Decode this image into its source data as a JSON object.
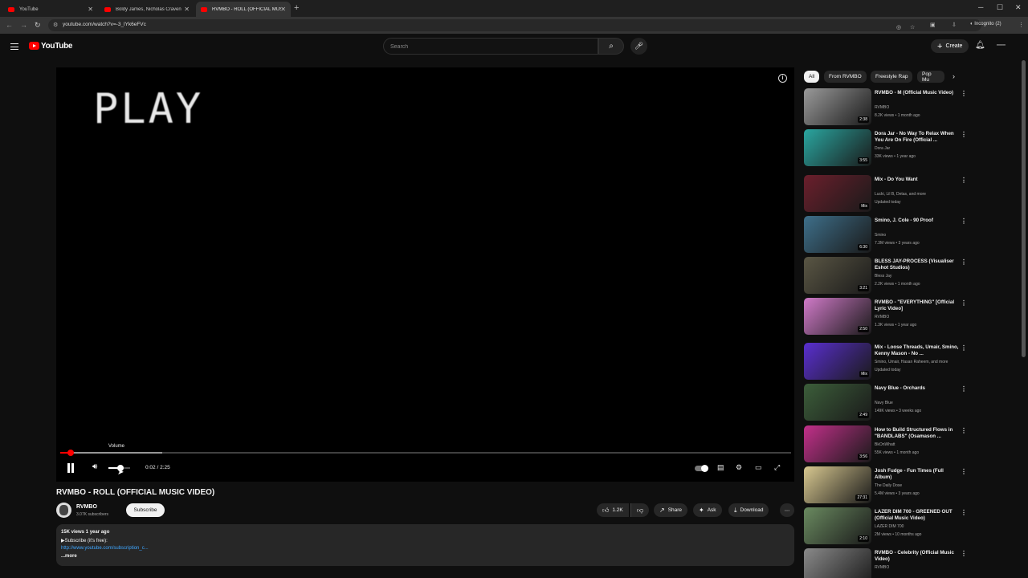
{
  "browser": {
    "tabs": [
      {
        "title": "YouTube"
      },
      {
        "title": "Boldy James, Nicholas Craven"
      },
      {
        "title": "RVMBO - ROLL (OFFICIAL MUSIC"
      }
    ],
    "url": "youtube.com/watch?v=-3_lYk6eFVc",
    "incognito_label": "Incognito (2)"
  },
  "header": {
    "logo_text": "YouTube",
    "search_placeholder": "Search",
    "create_label": "Create"
  },
  "player": {
    "overlay_text": "PLAY",
    "tooltip": "Volume",
    "time": "0:02 / 2:25",
    "progress_fraction": 0.014,
    "buffer_fraction": 0.14,
    "volume_fraction": 0.55
  },
  "video": {
    "title": "RVMBO - ROLL (OFFICIAL MUSIC VIDEO)",
    "channel": "RVMBO",
    "subscribers": "3.07K subscribers",
    "subscribe_label": "Subscribe",
    "likes": "1.2K",
    "share_label": "Share",
    "ask_label": "Ask",
    "download_label": "Download",
    "stats": "15K views  1 year ago",
    "desc_line1": "▶Subscribe (it's free):",
    "desc_link": "http://www.youtube.com/subscription_c...",
    "more_label": "...more"
  },
  "chips": [
    "All",
    "From RVMBO",
    "Freestyle Rap",
    "Pop Mu"
  ],
  "recommendations": [
    {
      "title": "RVMBO - M (Official Music Video)",
      "channel": "RVMBO",
      "meta": "8.2K views • 1 month ago",
      "duration": "2:38",
      "color": "#9a9a9a"
    },
    {
      "title": "Dora Jar - No Way To Relax When You Are On Fire (Official ...",
      "channel": "Dora Jar",
      "meta": "33K views • 1 year ago",
      "duration": "3:55",
      "color": "#2aa6a0"
    },
    {
      "title": "Mix - Do You Want",
      "channel": "Lucki, Lil B, Detas, and more",
      "meta": "Updated today",
      "duration": "Mix",
      "color": "#6b1f2c"
    },
    {
      "title": "Smino, J. Cole - 90 Proof",
      "channel": "Smino",
      "meta": "7.3M views • 3 years ago",
      "duration": "6:30",
      "color": "#3e6f8a"
    },
    {
      "title": "BLESS JAY-PROCESS (Visualiser Eshot Studios)",
      "channel": "Bless Jay",
      "meta": "2.2K views • 1 month ago",
      "duration": "3:21",
      "color": "#5a5644"
    },
    {
      "title": "RVMBO - \"EVERYTHING\" [Official Lyric Video]",
      "channel": "RVMBO",
      "meta": "1.3K views • 1 year ago",
      "duration": "2:50",
      "color": "#d07ac8"
    },
    {
      "title": "Mix - Loose Threads, Umair, Smino, Kenny Mason - No ...",
      "channel": "Smino, Umair, Hasan Raheem, and more",
      "meta": "Updated today",
      "duration": "Mix",
      "color": "#5a2fd0"
    },
    {
      "title": "Navy Blue - Orchards",
      "channel": "Navy Blue",
      "meta": "149K views • 3 weeks ago",
      "duration": "2:49",
      "color": "#3c5e3a"
    },
    {
      "title": "How to Build Structured Flows in \"BANDLABS\" (Osamason ...",
      "channel": "BkOnWhatt",
      "meta": "55K views • 1 month ago",
      "duration": "3:56",
      "color": "#c2308a"
    },
    {
      "title": "Josh Fudge - Fun Times (Full Album)",
      "channel": "The Daily Dose",
      "meta": "5.4M views • 3 years ago",
      "duration": "27:31",
      "color": "#d8c890"
    },
    {
      "title": "LAZER DIM 700 - GREENED OUT (Official Music Video)",
      "channel": "LAZER DIM 700",
      "meta": "2M views • 10 months ago",
      "duration": "2:10",
      "color": "#6a8a60"
    },
    {
      "title": "RVMBO - Celebrity (Official Music Video)",
      "channel": "RVMBO",
      "meta": "",
      "duration": "",
      "color": "#8a8a8a"
    }
  ]
}
